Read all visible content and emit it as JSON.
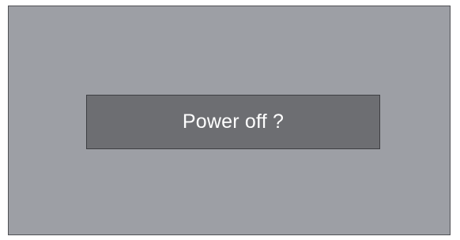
{
  "dialog": {
    "message": "Power off ?"
  },
  "colors": {
    "screen_background": "#9d9fa5",
    "dialog_background": "#6d6e72",
    "text": "#ffffff"
  }
}
